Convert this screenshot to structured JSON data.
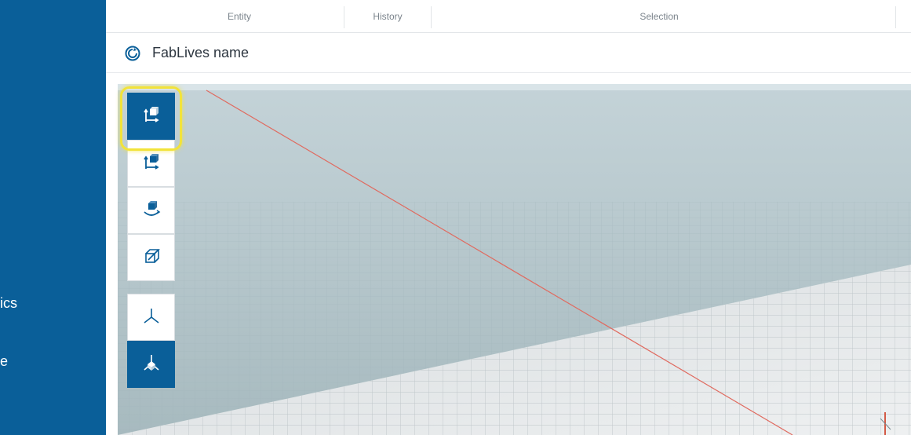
{
  "sidebar": {
    "items": [
      {
        "label": "ics"
      },
      {
        "label": "e"
      }
    ]
  },
  "tabs": [
    {
      "label": "Entity"
    },
    {
      "label": "History"
    },
    {
      "label": "Selection"
    }
  ],
  "header": {
    "title": "FabLives name",
    "icon": "refresh-icon"
  },
  "toolbar": {
    "tools": [
      {
        "name": "move-tool-icon",
        "active": true
      },
      {
        "name": "move-local-tool-icon",
        "active": false
      },
      {
        "name": "rotate-tool-icon",
        "active": false
      },
      {
        "name": "scale-tool-icon",
        "active": false
      },
      {
        "name": "axes-local-icon",
        "active": false
      },
      {
        "name": "axes-world-icon",
        "active": true
      }
    ]
  },
  "colors": {
    "brand": "#0a5f99",
    "highlight": "#f2e33a",
    "sky": "#b9c9cf",
    "axis_red": "#e06a5f"
  }
}
